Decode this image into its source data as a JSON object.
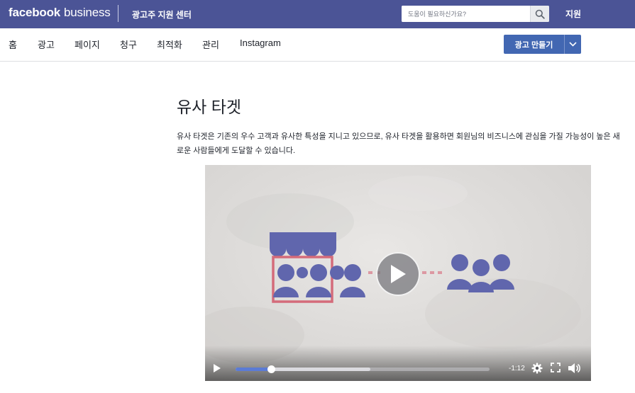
{
  "header": {
    "brand_bold": "facebook",
    "brand_light": "business",
    "center_title": "광고주 지원 센터",
    "search_placeholder": "도움이 필요하신가요?",
    "support_link": "지원"
  },
  "nav": {
    "items": [
      {
        "label": "홈"
      },
      {
        "label": "광고"
      },
      {
        "label": "페이지"
      },
      {
        "label": "청구"
      },
      {
        "label": "최적화"
      },
      {
        "label": "관리"
      },
      {
        "label": "Instagram"
      }
    ],
    "create_ad_label": "광고 만들기"
  },
  "article": {
    "title": "유사 타겟",
    "description": "유사 타겟은 기존의 우수 고객과 유사한 특성을 지니고 있으므로, 유사 타겟을 활용하면 회원님의 비즈니스에 관심을 가질 가능성이 높은 새로운 사람들에게 도달할 수 있습니다."
  },
  "video": {
    "time_remaining": "-1:12",
    "progress": 0.14,
    "buffered": 0.53,
    "colors": {
      "illustration": "#6066ad",
      "highlight_box": "#d46b7a",
      "progress": "#5b7bd5"
    }
  },
  "colors": {
    "topbar": "#4b5496",
    "button": "#4267b2"
  }
}
